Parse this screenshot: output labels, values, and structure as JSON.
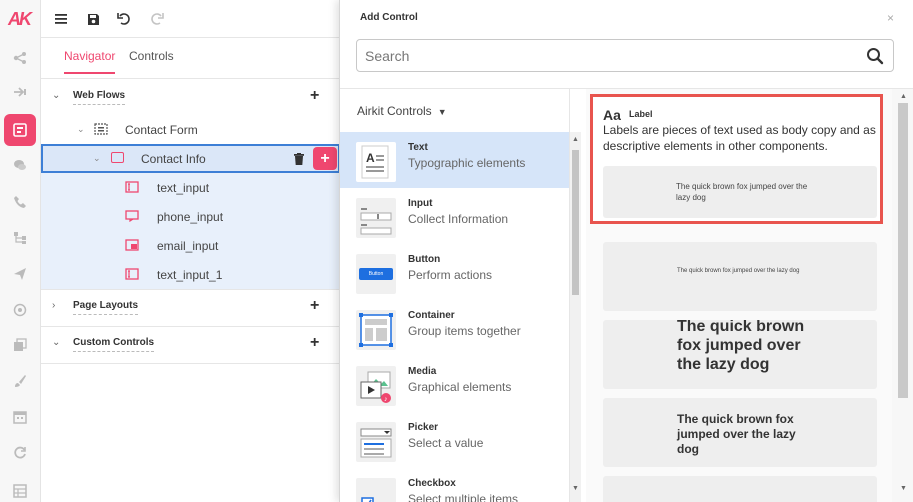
{
  "brand": {
    "logo_text": "AK",
    "accent": "#ef476f"
  },
  "rail": {
    "icons": [
      "flows-icon",
      "connections-icon",
      "web-form-icon",
      "chat-icon",
      "phone-icon",
      "tree-icon",
      "send-icon",
      "globe-icon",
      "media-icon",
      "brush-icon",
      "calendar-icon",
      "refresh-icon",
      "table-icon"
    ]
  },
  "toolbar": {
    "icons": [
      "menu-icon",
      "save-icon",
      "undo-icon",
      "redo-icon"
    ]
  },
  "tabs": [
    {
      "label": "Navigator",
      "active": true
    },
    {
      "label": "Controls",
      "active": false
    }
  ],
  "tree": {
    "web_flows": "Web Flows",
    "contact_form": "Contact Form",
    "contact_info": "Contact Info",
    "children": [
      "text_input",
      "phone_input",
      "email_input",
      "text_input_1"
    ],
    "page_layouts": "Page Layouts",
    "custom_controls": "Custom Controls"
  },
  "modal": {
    "title": "Add Control",
    "close": "×",
    "search_placeholder": "Search",
    "category": "Airkit Controls",
    "items": [
      {
        "name": "Text",
        "desc": "Typographic elements",
        "active": true
      },
      {
        "name": "Input",
        "desc": "Collect Information",
        "active": false
      },
      {
        "name": "Button",
        "desc": "Perform actions",
        "active": false,
        "thumb_text": "Button"
      },
      {
        "name": "Container",
        "desc": "Group items together",
        "active": false
      },
      {
        "name": "Media",
        "desc": "Graphical elements",
        "active": false
      },
      {
        "name": "Picker",
        "desc": "Select a value",
        "active": false
      },
      {
        "name": "Checkbox",
        "desc": "Select multiple items",
        "active": false
      }
    ],
    "preview": {
      "aa": "Aa",
      "label_name": "Label",
      "label_desc": "Labels are pieces of text used as body copy and as descriptive elements in other components.",
      "sample1": "The quick brown fox jumped over the lazy dog",
      "sample2": "The quick brown fox jumped over the lazy dog",
      "sample3": "The quick brown fox jumped over the lazy dog",
      "sample4": "The quick brown fox jumped over the lazy dog"
    }
  }
}
